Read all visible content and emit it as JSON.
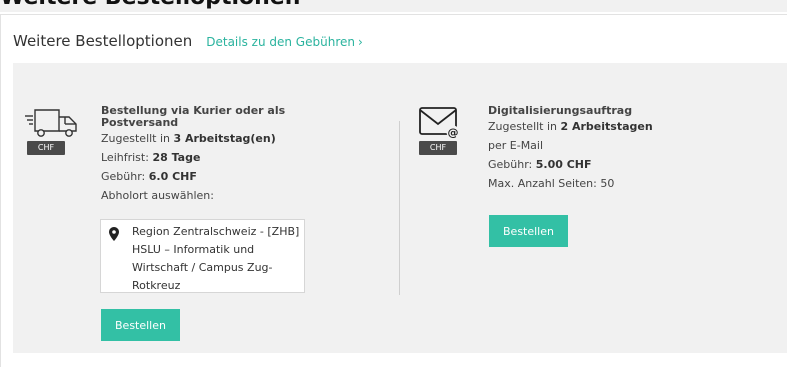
{
  "page": {
    "heading": "Weitere Bestelloptionen"
  },
  "panel": {
    "title": "Weitere Bestelloptionen",
    "fees_link": "Details zu den Gebühren",
    "fees_chevron": "›"
  },
  "courier": {
    "icon": "truck-icon",
    "badge": "CHF",
    "title_line1": "Bestellung via Kurier oder als",
    "title_line2": "Postversand",
    "delivery_prefix": "Zugestellt in ",
    "delivery_value": "3 Arbeitstag(en)",
    "loan_prefix": "Leihfrist: ",
    "loan_value": "28 Tage",
    "fee_prefix": "Gebühr: ",
    "fee_value": "6.0 CHF",
    "pickup_label": "Abholort auswählen:",
    "pickup_location": "Region Zentralschweiz - [ZHB] HSLU – Informatik und Wirtschaft / Campus Zug-Rotkreuz",
    "order_button": "Bestellen"
  },
  "digital": {
    "icon": "email-icon",
    "badge": "CHF",
    "title": "Digitalisierungsauftrag",
    "delivery_prefix": "Zugestellt in ",
    "delivery_value": "2 Arbeitstagen",
    "method": "per E-Mail",
    "fee_prefix": "Gebühr: ",
    "fee_value": "5.00 CHF",
    "max_pages": "Max. Anzahl Seiten: 50",
    "order_button": "Bestellen"
  },
  "colors": {
    "accent": "#33c0a5",
    "link": "#2ab39e",
    "badge": "#4a4a4a",
    "panel_bg": "#f1f1f1"
  }
}
